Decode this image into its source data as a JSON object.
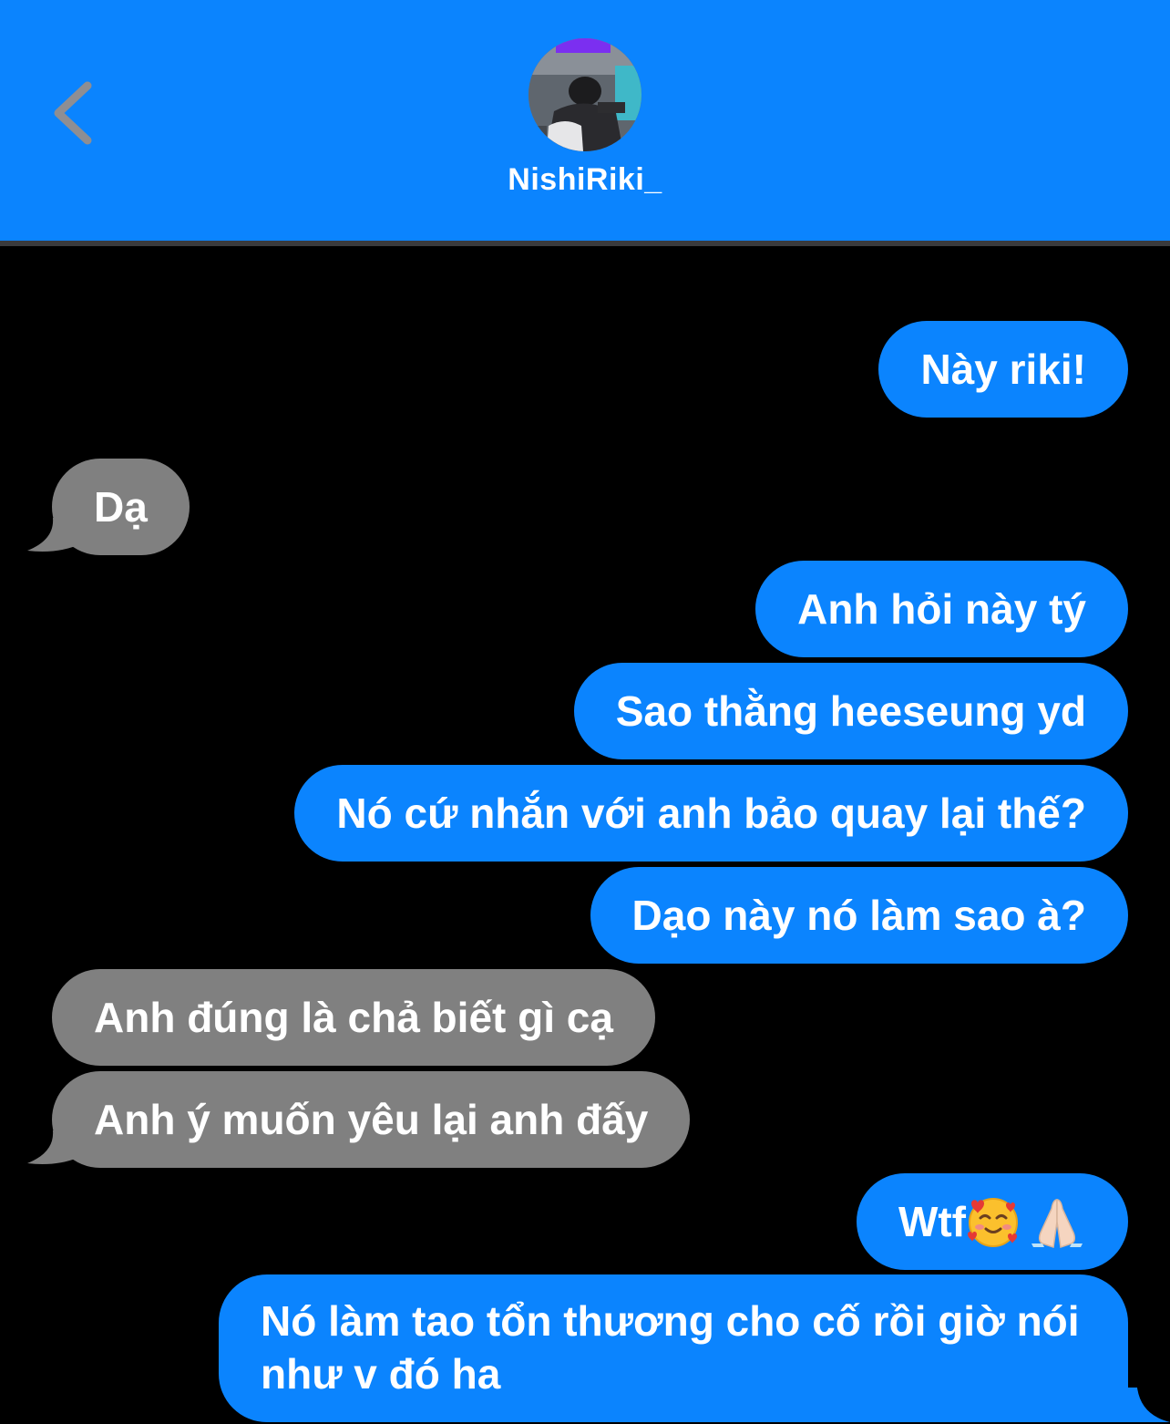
{
  "header": {
    "contact_name": "NishiRiki_",
    "back_icon": "chevron-left-icon",
    "background_color": "#0b84fe"
  },
  "colors": {
    "sent_bubble": "#0b84fe",
    "received_bubble": "#808080",
    "background": "#000000"
  },
  "messages": [
    {
      "direction": "sent",
      "text": "Này riki!"
    },
    {
      "direction": "received",
      "text": "Dạ"
    },
    {
      "direction": "sent",
      "text": "Anh hỏi này tý"
    },
    {
      "direction": "sent",
      "text": "Sao thằng heeseung yd"
    },
    {
      "direction": "sent",
      "text": "Nó cứ nhắn với anh bảo quay lại thế?"
    },
    {
      "direction": "sent",
      "text": "Dạo này nó làm sao à?"
    },
    {
      "direction": "received",
      "text": "Anh đúng là chả biết gì cạ"
    },
    {
      "direction": "received",
      "text": "Anh ý muốn yêu lại anh đấy"
    },
    {
      "direction": "sent",
      "text": "Wtf",
      "emojis": [
        "smiling-face-with-hearts-emoji",
        "folded-hands-emoji"
      ]
    },
    {
      "direction": "sent",
      "text": "Nó làm tao tổn thương cho cố rồi giờ nói như v đó ha"
    }
  ]
}
